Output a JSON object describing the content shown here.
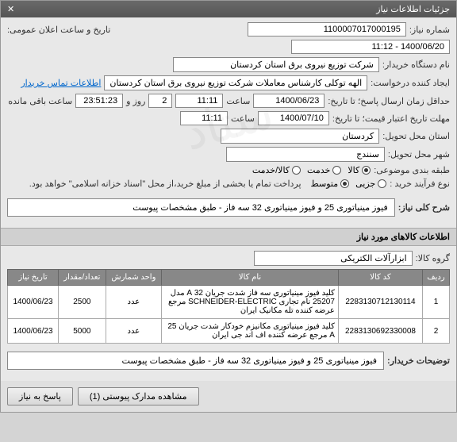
{
  "header": {
    "title": "جزئیات اطلاعات نیاز",
    "close_icon": "✕"
  },
  "fields": {
    "need_no_label": "شماره نیاز:",
    "need_no": "1100007017000195",
    "pub_date_label": "تاریخ و ساعت اعلان عمومی:",
    "pub_date": "1400/06/20 - 11:12",
    "buyer_label": "نام دستگاه خریدار:",
    "buyer": "شرکت توزیع نیروی برق استان کردستان",
    "requester_label": "ایجاد کننده درخواست:",
    "requester": "الهه توکلی کارشناس معاملات شرکت توزیع نیروی برق استان کردستان",
    "contact_link": "اطلاعات تماس خریدار",
    "deadline_label": "حداقل زمان ارسال پاسخ؛ تا تاریخ:",
    "deadline_date": "1400/06/23",
    "time_label": "ساعت",
    "deadline_time": "11:11",
    "day_label": "روز و",
    "days": "2",
    "remain_time": "23:51:23",
    "remain_suffix": "ساعت باقی مانده",
    "validity_label": "مهلت تاریخ اعتبار قیمت؛ تا تاریخ:",
    "validity_date": "1400/07/10",
    "validity_time": "11:11",
    "province_label": "استان محل تحویل:",
    "province": "کردستان",
    "city_label": "شهر محل تحویل:",
    "city": "سنندج",
    "category_label": "طبقه بندی موضوعی:",
    "cat_opts": [
      "کالا",
      "خدمت",
      "کالا/خدمت"
    ],
    "cat_sel": 0,
    "process_label": "نوع فرآیند خرید :",
    "proc_opts": [
      "جزیی",
      "متوسط"
    ],
    "proc_sel": 1,
    "process_note": "پرداخت تمام یا بخشی از مبلغ خرید،از محل \"اسناد خزانه اسلامی\" خواهد بود."
  },
  "sections": {
    "desc_title": "شرح کلی نیاز:",
    "desc_text": "فیوز مینیاتوری 25 و فیوز مینیاتوری 32 سه فاز - طبق مشخصات پیوست",
    "items_title": "اطلاعات کالاهای مورد نیاز",
    "group_label": "گروه کالا:",
    "group": "ابزارآلات الکتریکی",
    "buyer_note_label": "توضیحات خریدار:",
    "buyer_note": "فیوز مینیاتوری 25 و فیوز مینیاتوری 32 سه فاز - طبق مشخصات پیوست"
  },
  "table": {
    "headers": [
      "ردیف",
      "کد کالا",
      "نام کالا",
      "واحد شمارش",
      "تعداد/مقدار",
      "تاریخ نیاز"
    ],
    "rows": [
      {
        "n": "1",
        "code": "2283130712130114",
        "name": "کلید فیوز مینیاتوری سه فاز شدت جریان 32 A مدل 25207 نام تجاری SCHNEIDER-ELECTRIC مرجع عرضه کننده تله مکانیک ایران",
        "unit": "عدد",
        "qty": "2500",
        "date": "1400/06/23"
      },
      {
        "n": "2",
        "code": "2283130692330008",
        "name": "کلید فیوز مینیاتوری مکانیزم خودکار شدت جریان 25 A مرجع عرضه کننده اف اند جی ایران",
        "unit": "عدد",
        "qty": "5000",
        "date": "1400/06/23"
      }
    ]
  },
  "footer": {
    "attachments": "مشاهده مدارک پیوستی (1)",
    "reply": "پاسخ به نیاز"
  }
}
